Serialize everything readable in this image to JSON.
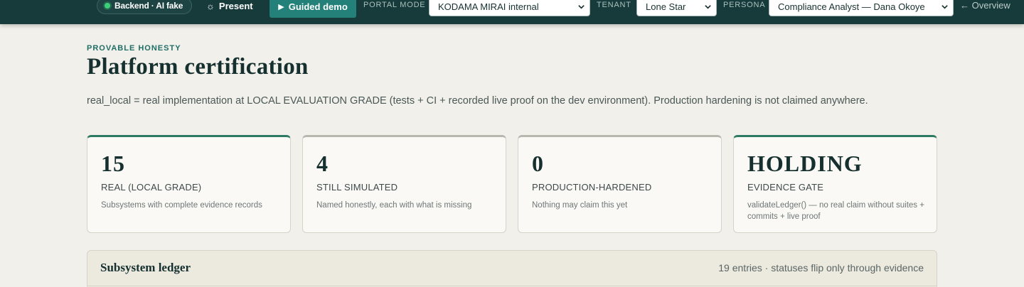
{
  "topbar": {
    "backend_badge": "Backend · AI fake",
    "present_label": "Present",
    "guided_demo_label": "Guided demo",
    "portal_mode_label": "PORTAL MODE",
    "portal_mode_value": "KODAMA MIRAI internal",
    "tenant_label": "TENANT",
    "tenant_value": "Lone Star",
    "persona_label": "PERSONA",
    "persona_value": "Compliance Analyst — Dana Okoye",
    "overview_link": "← Overview"
  },
  "header": {
    "eyebrow": "PROVABLE HONESTY",
    "title": "Platform certification",
    "intro": "real_local = real implementation at LOCAL EVALUATION GRADE (tests + CI + recorded live proof on the dev environment). Production hardening is not claimed anywhere."
  },
  "stats": [
    {
      "value": "15",
      "label": "REAL (LOCAL GRADE)",
      "description": "Subsystems with complete evidence records"
    },
    {
      "value": "4",
      "label": "STILL SIMULATED",
      "description": "Named honestly, each with what is missing"
    },
    {
      "value": "0",
      "label": "PRODUCTION-HARDENED",
      "description": "Nothing may claim this yet"
    },
    {
      "value": "HOLDING",
      "label": "EVIDENCE GATE",
      "description": "validateLedger() — no real claim without suites + commits + live proof"
    }
  ],
  "ledger": {
    "title": "Subsystem ledger",
    "meta": "19 entries · statuses flip only through evidence"
  },
  "colors": {
    "topbar": "#173a3a",
    "accent": "#23817a",
    "status_ok": "#3ccf7a",
    "card_top_green": "#2f7a63",
    "card_top_neutral": "#b8b6ad",
    "page_bg": "#f2f0ea"
  },
  "icons": {
    "status_dot": "green-status-dot-icon",
    "present": "sun-icon",
    "guided_demo": "play-icon",
    "select": "chevron-down-icon"
  }
}
